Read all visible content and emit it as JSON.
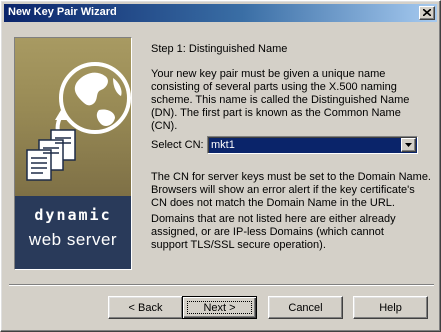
{
  "window": {
    "title": "New Key Pair Wizard"
  },
  "titlebar": {
    "close_icon": "close-x-icon"
  },
  "side_panel": {
    "brand_line1": "dynamic",
    "brand_line2": "web server",
    "artwork": "globe-and-documents-illustration",
    "colors": {
      "gold": "#a89a62",
      "navy": "#293a5a"
    }
  },
  "step": {
    "title": "Step 1: Distinguished Name",
    "intro": "Your new key pair must be given a unique name consisting of several parts using the X.500 naming scheme. This name is called the Distinguished Name (DN). The first part is known as the Common Name (CN).",
    "cn_label": "Select CN:",
    "cn_value": "mkt1",
    "note": "The CN for server keys must be set to the Domain Name. Browsers will show an error alert if the key certificate's CN does not match the Domain Name in the URL.",
    "domains_note": "Domains that are not listed here are either already assigned, or are IP-less Domains (which cannot support TLS/SSL secure operation)."
  },
  "buttons": {
    "back": "< Back",
    "next": "Next >",
    "cancel": "Cancel",
    "help": "Help"
  },
  "colors": {
    "titlebar_start": "#0a246a",
    "titlebar_end": "#a6caf0",
    "face": "#d4d0c8",
    "selection": "#0a246a"
  }
}
